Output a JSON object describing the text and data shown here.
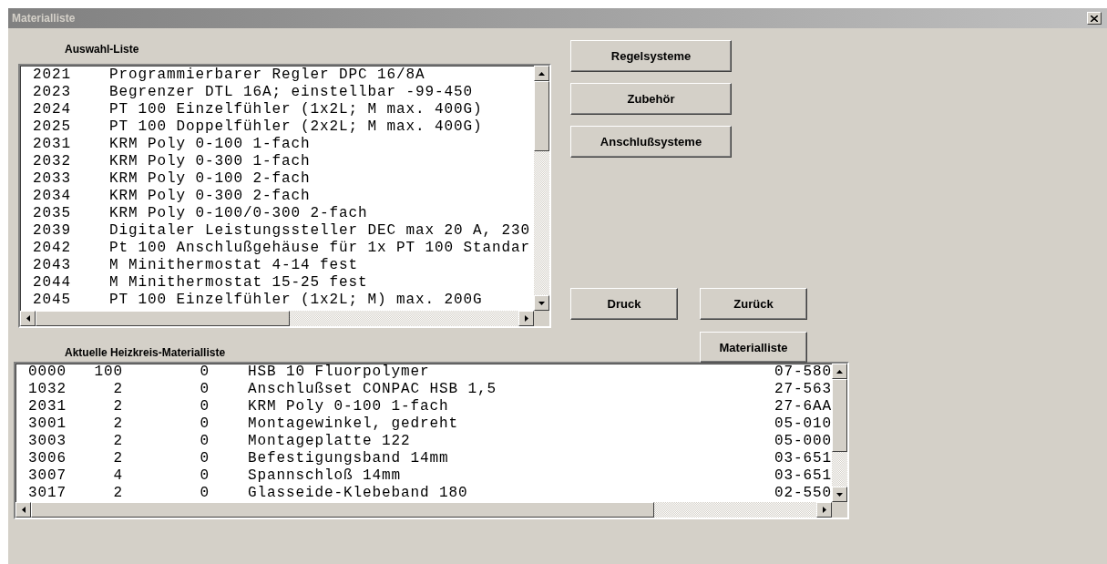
{
  "window": {
    "title": "Materialliste"
  },
  "selection_list": {
    "label": "Auswahl-Liste",
    "rows": [
      {
        "code": "2021",
        "description": "Programmierbarer Regler DPC 16/8A"
      },
      {
        "code": "2023",
        "description": "Begrenzer DTL 16A; einstellbar -99-450"
      },
      {
        "code": "2024",
        "description": "PT 100 Einzelfühler (1x2L; M max. 400G)"
      },
      {
        "code": "2025",
        "description": "PT 100 Doppelfühler (2x2L; M max. 400G)"
      },
      {
        "code": "2031",
        "description": "KRM Poly 0-100 1-fach"
      },
      {
        "code": "2032",
        "description": "KRM Poly 0-300 1-fach"
      },
      {
        "code": "2033",
        "description": "KRM Poly 0-100 2-fach"
      },
      {
        "code": "2034",
        "description": "KRM Poly 0-300 2-fach"
      },
      {
        "code": "2035",
        "description": "KRM Poly 0-100/0-300 2-fach"
      },
      {
        "code": "2039",
        "description": "Digitaler Leistungssteller DEC max 20 A, 230"
      },
      {
        "code": "2042",
        "description": "Pt 100 Anschlußgehäuse für 1x PT 100 Standar"
      },
      {
        "code": "2043",
        "description": "M Minithermostat 4-14 fest"
      },
      {
        "code": "2044",
        "description": "M Minithermostat 15-25 fest"
      },
      {
        "code": "2045",
        "description": "PT 100 Einzelfühler (1x2L; M) max. 200G"
      }
    ]
  },
  "category_buttons": [
    "Regelsysteme",
    "Zubehör",
    "Anschlußsysteme"
  ],
  "action_buttons": [
    "Druck",
    "Zurück"
  ],
  "list_button": "Materialliste",
  "material_list": {
    "label": "Aktuelle Heizkreis-Materialliste",
    "rows": [
      {
        "code": "0000",
        "quantity": "100",
        "column_3": "0",
        "description": "HSB 10  Fluorpolymer",
        "column_5": "07-580"
      },
      {
        "code": "1032",
        "quantity": "2",
        "column_3": "0",
        "description": "Anschlußset CONPAC HSB 1,5",
        "column_5": "27-563"
      },
      {
        "code": "2031",
        "quantity": "2",
        "column_3": "0",
        "description": "KRM Poly 0-100 1-fach",
        "column_5": "27-6AA"
      },
      {
        "code": "3001",
        "quantity": "2",
        "column_3": "0",
        "description": "Montagewinkel, gedreht",
        "column_5": "05-010"
      },
      {
        "code": "3003",
        "quantity": "2",
        "column_3": "0",
        "description": "Montageplatte 122",
        "column_5": "05-000"
      },
      {
        "code": "3006",
        "quantity": "2",
        "column_3": "0",
        "description": "Befestigungsband 14mm",
        "column_5": "03-651"
      },
      {
        "code": "3007",
        "quantity": "4",
        "column_3": "0",
        "description": "Spannschloß 14mm",
        "column_5": "03-651"
      },
      {
        "code": "3017",
        "quantity": "2",
        "column_3": "0",
        "description": "Glasseide-Klebeband 180",
        "column_5": "02-550"
      }
    ]
  }
}
